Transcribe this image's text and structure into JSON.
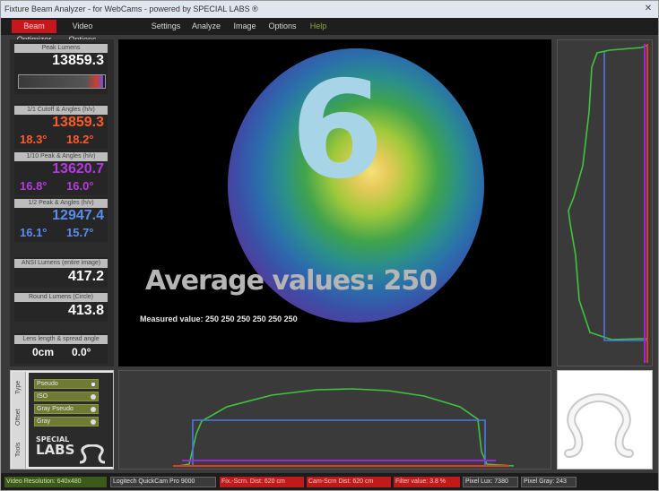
{
  "window": {
    "title": "Fixture Beam Analyzer - for WebCams - powered by SPECIAL LABS ®",
    "close_glyph": "✕"
  },
  "menu": [
    {
      "label": "Beam Optimizer",
      "active": true
    },
    {
      "label": "Video Options"
    },
    {
      "label": "Settings"
    },
    {
      "label": "Analyze"
    },
    {
      "label": "Image"
    },
    {
      "label": "Options"
    },
    {
      "label": "Help"
    }
  ],
  "readouts": {
    "peak": {
      "label": "Peak Lumens",
      "value": "13859.3",
      "meter_fraction": 0.98
    },
    "cutoff": {
      "label": "1/1 Cutoff & Angles (h/v)",
      "value": "13859.3",
      "angle_h": "18.3°",
      "angle_v": "18.2°"
    },
    "field": {
      "label": "1/10 Peak & Angles (h/v)",
      "value": "13620.7",
      "angle_h": "16.8°",
      "angle_v": "16.0°"
    },
    "beam": {
      "label": "1/2 Peak & Angles (h/v)",
      "value": "12947.4",
      "angle_h": "16.1°",
      "angle_v": "15.7°"
    },
    "ansi": {
      "label": "ANSI Lumens (entire image)",
      "value": "417.2"
    },
    "round": {
      "label": "Round Lumens (Circle)",
      "value": "413.8"
    },
    "lens": {
      "label": "Lens length & spread angle",
      "distance": "0cm",
      "angle": "0.0°"
    }
  },
  "overlay": {
    "digit": "6",
    "average_text": "Average values: 250",
    "measured_text": "Measured value: 250  250  250  250  250  250"
  },
  "tools": {
    "tabs": [
      "Type",
      "Offset",
      "Tools"
    ],
    "options": [
      {
        "label": "Pseudo",
        "checked": true
      },
      {
        "label": "ISO",
        "checked": false
      },
      {
        "label": "Gray Pseudo",
        "checked": false
      },
      {
        "label": "Gray",
        "checked": false
      }
    ],
    "logo_line1": "SPECIAL",
    "logo_line2": "LABS"
  },
  "status": [
    {
      "text": "Video Resolution: 640x480",
      "style": "green"
    },
    {
      "text": "Logitech QuickCam Pro 9000",
      "style": "gray"
    },
    {
      "text": "Fix.-Scrn. Dist: 620 cm",
      "style": "red"
    },
    {
      "text": "Cam-Scrn Dist: 620 cm",
      "style": "red"
    },
    {
      "text": "Filter value: 3.8 %",
      "style": "red"
    },
    {
      "text": "Pixel Lux: 7380",
      "style": "gray"
    },
    {
      "text": "Pixel Gray: 243",
      "style": "gray"
    }
  ],
  "colors": {
    "menu_active": "#c8161d",
    "peak_value": "#ffffff",
    "cutoff": "#ff5a2a",
    "field": "#b43ae0",
    "beam": "#5a8cf0",
    "profile_green": "#3ec43e",
    "profile_blue": "#4a78e0",
    "profile_purple": "#9a2ad8",
    "profile_red": "#e03a20"
  }
}
